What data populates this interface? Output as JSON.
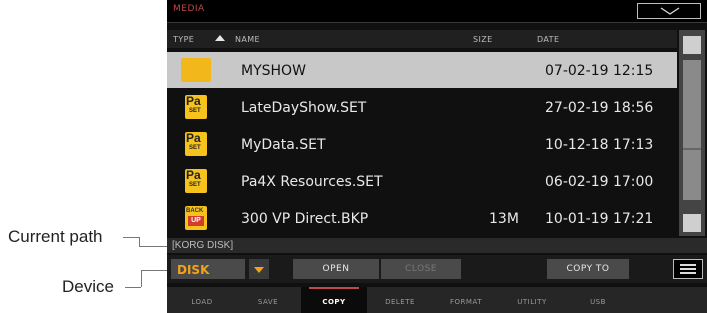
{
  "annotations": {
    "current_path": "Current path",
    "device": "Device"
  },
  "screen": {
    "title": "MEDIA",
    "columns": {
      "type": "TYPE",
      "name": "NAME",
      "size": "SIZE",
      "date": "DATE"
    },
    "files": [
      {
        "icon": "folder-icon",
        "name": "MYSHOW",
        "size": "",
        "date": "07-02-19 12:15",
        "selected": true
      },
      {
        "icon": "pa-set-icon",
        "name": "LateDayShow.SET",
        "size": "",
        "date": "27-02-19 18:56"
      },
      {
        "icon": "pa-set-icon",
        "name": "MyData.SET",
        "size": "",
        "date": "10-12-18 17:13"
      },
      {
        "icon": "pa-set-icon",
        "name": "Pa4X Resources.SET",
        "size": "",
        "date": "06-02-19 17:00"
      },
      {
        "icon": "backup-icon",
        "name": "300 VP Direct.BKP",
        "size": "13M",
        "date": "10-01-19 17:21"
      }
    ],
    "icon_text": {
      "pa": "Pa",
      "set": "SET",
      "back": "BACK",
      "up": "UP"
    },
    "current_path": "[KORG DISK]",
    "device": "DISK",
    "buttons": {
      "open": "OPEN",
      "close": "CLOSE",
      "copy_to": "COPY TO"
    },
    "tabs": [
      "LOAD",
      "SAVE",
      "COPY",
      "DELETE",
      "FORMAT",
      "UTILITY",
      "USB"
    ],
    "active_tab": "COPY",
    "colors": {
      "accent": "#c04848",
      "device_text": "#f2a21b",
      "folder": "#f2b81b",
      "selection": "#c8c8c8"
    }
  }
}
